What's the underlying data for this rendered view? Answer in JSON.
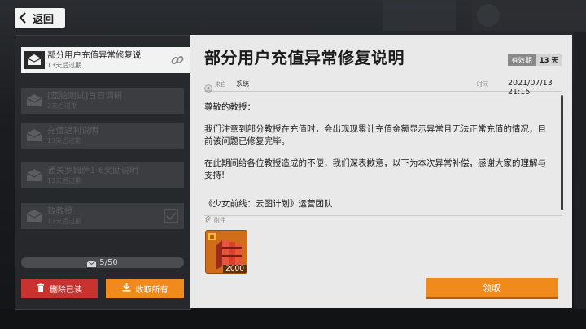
{
  "nav": {
    "back_label": "返回"
  },
  "mail_list": {
    "items": [
      {
        "title": "部分用户充值异常修复说",
        "expire": "13天后过期",
        "selected": true
      },
      {
        "title": "[蓝脑测试]首日调研",
        "expire": "2天后过期",
        "selected": false
      },
      {
        "title": "充值返利说明",
        "expire": "13天后过期",
        "selected": false
      },
      {
        "title": "通关罗姆萨1-6奖励说明",
        "expire": "13天后过期",
        "selected": false
      },
      {
        "title": "致教授",
        "expire": "13天后过期",
        "selected": false
      }
    ],
    "count": "5/50",
    "delete_read_label": "删除已读",
    "collect_all_label": "收取所有"
  },
  "mail_detail": {
    "title": "部分用户充值异常修复说明",
    "validity_label": "有效期",
    "validity_value": "13 天",
    "from_label": "来自",
    "from_value": "系统",
    "time_label": "时间",
    "time_value": "2021/07/13 21:15",
    "body": {
      "greeting": "尊敬的教授：",
      "para1": "我们注意到部分教授在充值时，会出现现累计充值金额显示异常且无法正常充值的情况，目前该问题已修复完毕。",
      "para2": "在此期间给各位教授造成的不便，我们深表歉意，以下为本次异常补偿，感谢大家的理解与支持!",
      "signature": "《少女前线：云图计划》运营团队"
    },
    "attachment_label": "附件",
    "attachment_qty": "2000",
    "claim_label": "领取"
  },
  "colors": {
    "accent_orange": "#f08a1c",
    "delete_red": "#c8322f",
    "panel_light": "#e9e9e9"
  }
}
